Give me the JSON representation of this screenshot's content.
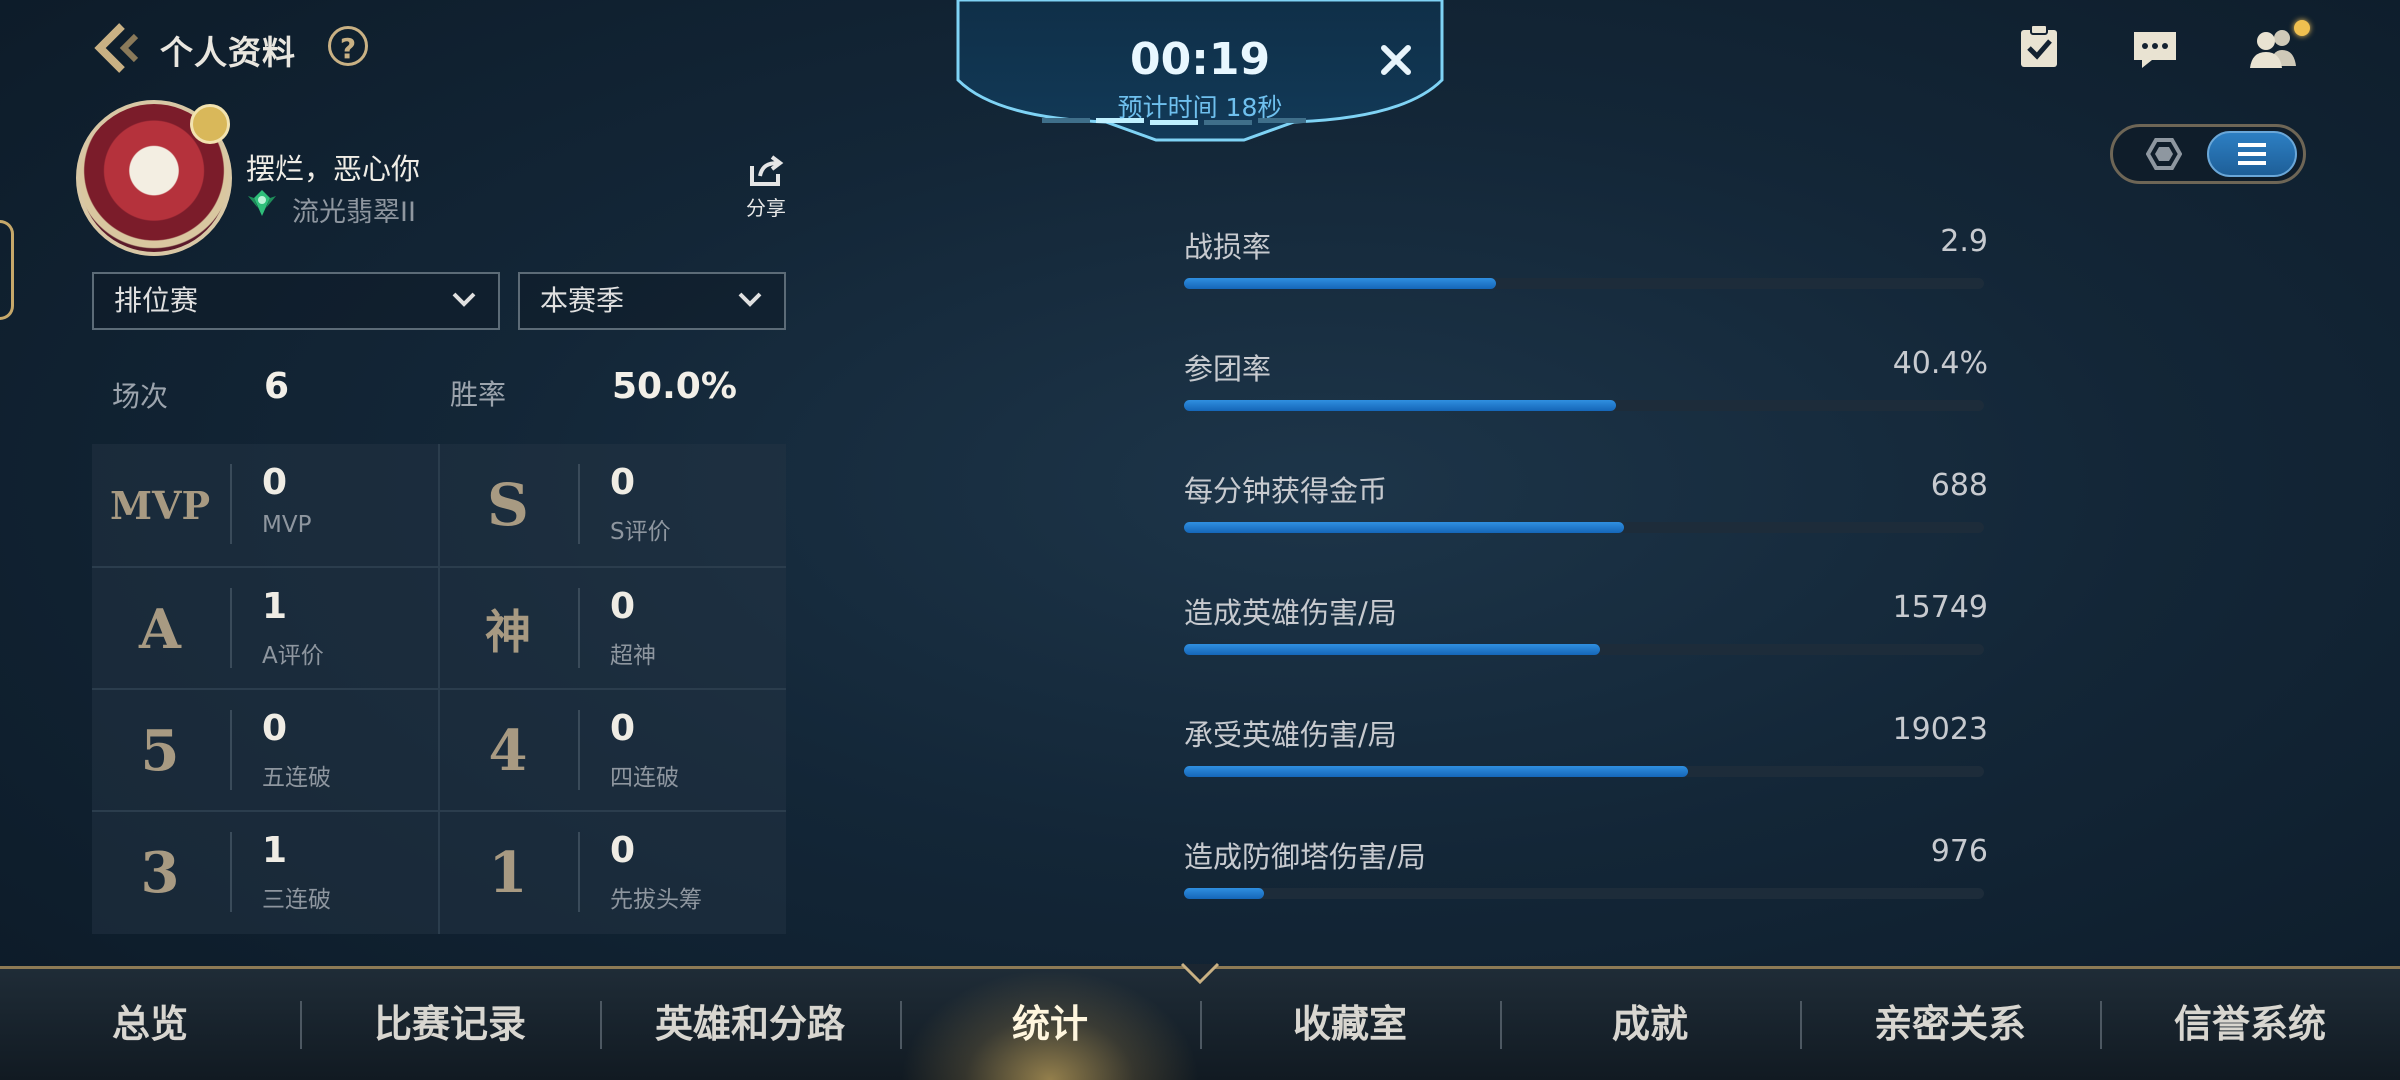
{
  "header": {
    "title": "个人资料",
    "help": "?"
  },
  "profile": {
    "name": "摆烂，恶心你",
    "rank": "流光翡翠II",
    "share_label": "分享"
  },
  "filters": {
    "mode": "排位赛",
    "season": "本赛季"
  },
  "basic": {
    "games_label": "场次",
    "games_value": "6",
    "winrate_label": "胜率",
    "winrate_value": "50.0%"
  },
  "medals": [
    {
      "emblem": "MVP",
      "value": "0",
      "label": "MVP"
    },
    {
      "emblem": "S",
      "value": "0",
      "label": "S评价"
    },
    {
      "emblem": "A",
      "value": "1",
      "label": "A评价"
    },
    {
      "emblem": "神",
      "value": "0",
      "label": "超神"
    },
    {
      "emblem": "5",
      "value": "0",
      "label": "五连破"
    },
    {
      "emblem": "4",
      "value": "0",
      "label": "四连破"
    },
    {
      "emblem": "3",
      "value": "1",
      "label": "三连破"
    },
    {
      "emblem": "1",
      "value": "0",
      "label": "先拔头筹"
    }
  ],
  "stats": [
    {
      "label": "战损率",
      "value": "2.9",
      "fill": 0.39
    },
    {
      "label": "参团率",
      "value": "40.4%",
      "fill": 0.54
    },
    {
      "label": "每分钟获得金币",
      "value": "688",
      "fill": 0.55
    },
    {
      "label": "造成英雄伤害/局",
      "value": "15749",
      "fill": 0.52
    },
    {
      "label": "承受英雄伤害/局",
      "value": "19023",
      "fill": 0.63
    },
    {
      "label": "造成防御塔伤害/局",
      "value": "976",
      "fill": 0.1
    }
  ],
  "timer": {
    "time": "00:19",
    "estimate": "预计时间 18秒"
  },
  "tabs": [
    {
      "label": "总览"
    },
    {
      "label": "比赛记录"
    },
    {
      "label": "英雄和分路"
    },
    {
      "label": "统计",
      "active": true
    },
    {
      "label": "收藏室"
    },
    {
      "label": "成就"
    },
    {
      "label": "亲密关系"
    },
    {
      "label": "信誉系统"
    }
  ],
  "colors": {
    "accent_gold": "#c9b184",
    "bar_blue": "#1e78cf",
    "timer_cyan": "#6fc0ee"
  }
}
